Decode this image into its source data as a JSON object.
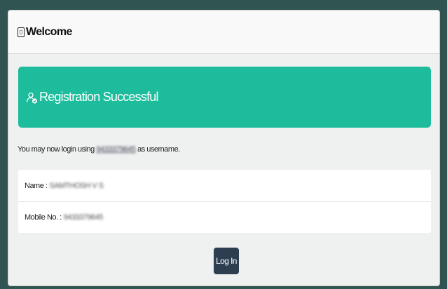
{
  "header": {
    "icon": "mobile-phone-icon",
    "title": "Welcome"
  },
  "banner": {
    "icon": "user-check-icon",
    "text": "Registration Successful",
    "color": "#1cbc9c"
  },
  "info": {
    "prefix": "You may now login using",
    "username": "9433379645",
    "suffix": "as username."
  },
  "details": [
    {
      "label": "Name :",
      "value": "SAMTHOSH V S"
    },
    {
      "label": "Mobile No. :",
      "value": "9433379645"
    }
  ],
  "actions": {
    "login_label": "Log In",
    "login_color": "#2d3e50"
  }
}
